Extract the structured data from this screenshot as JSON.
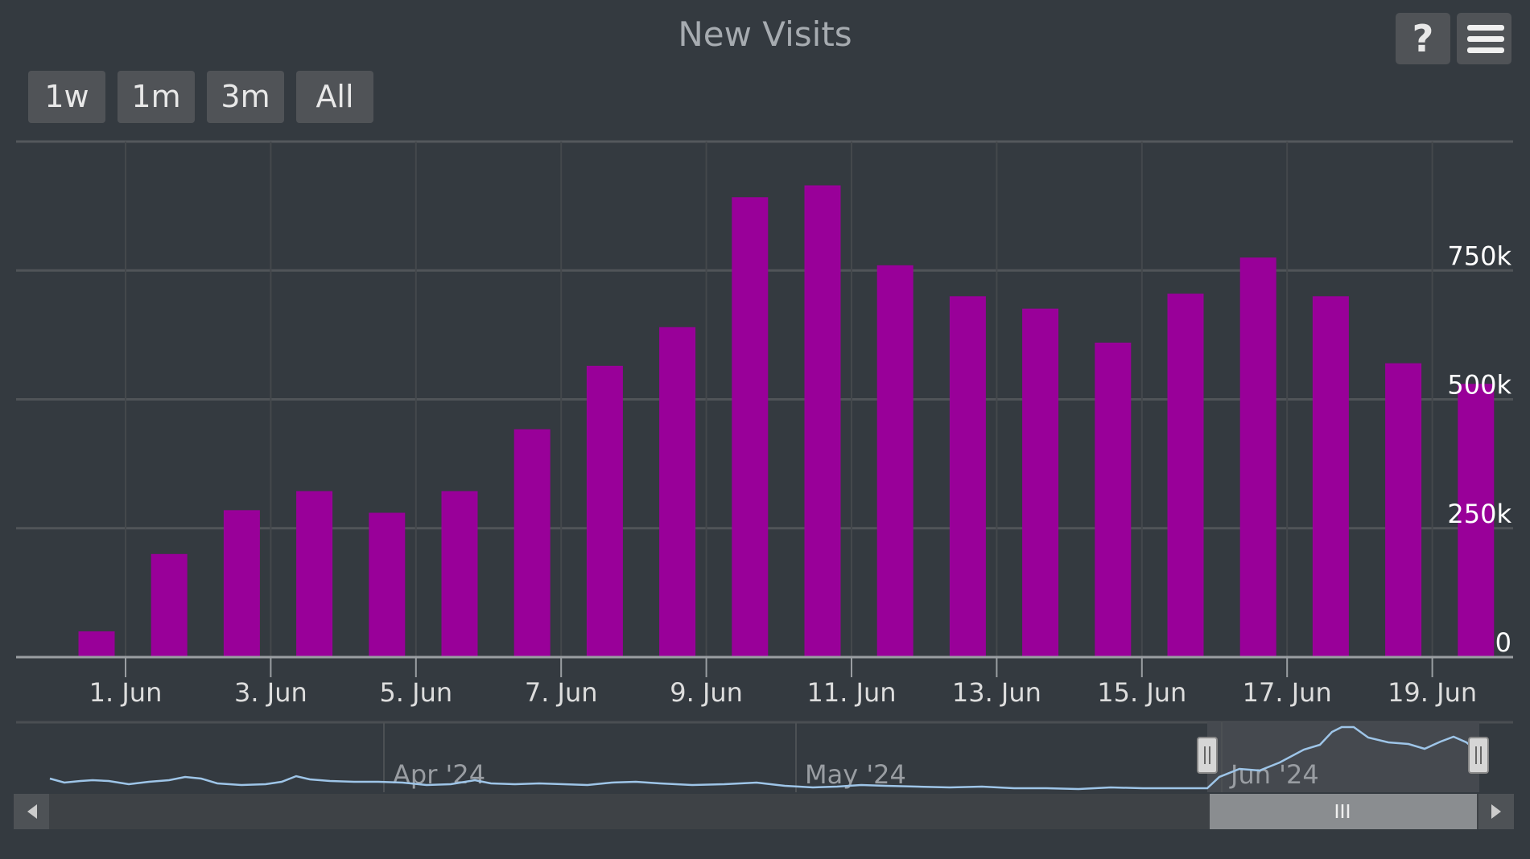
{
  "title": "New Visits",
  "range_selector": {
    "buttons": [
      {
        "label": "1w"
      },
      {
        "label": "1m"
      },
      {
        "label": "3m"
      },
      {
        "label": "All"
      }
    ]
  },
  "toolbar": {
    "help_label": "?",
    "help_icon": "question-icon",
    "menu_icon": "hamburger-menu-icon"
  },
  "colors": {
    "background": "#343a40",
    "bar": "#990099",
    "navigator_line": "#9ec5e8"
  },
  "chart_data": {
    "type": "bar",
    "x": [
      "1. Jun",
      "2. Jun",
      "3. Jun",
      "4. Jun",
      "5. Jun",
      "6. Jun",
      "7. Jun",
      "8. Jun",
      "9. Jun",
      "10. Jun",
      "11. Jun",
      "12. Jun",
      "13. Jun",
      "14. Jun",
      "15. Jun",
      "16. Jun",
      "17. Jun",
      "18. Jun",
      "19. Jun",
      "20. Jun"
    ],
    "values": [
      50000,
      200000,
      285000,
      322000,
      280000,
      322000,
      442000,
      565000,
      640000,
      892000,
      915000,
      760000,
      700000,
      676000,
      610000,
      705000,
      775000,
      700000,
      570000,
      530000
    ],
    "x_tick_labels": [
      "1. Jun",
      "3. Jun",
      "5. Jun",
      "7. Jun",
      "9. Jun",
      "11. Jun",
      "13. Jun",
      "15. Jun",
      "17. Jun",
      "19. Jun"
    ],
    "y_ticks": [
      0,
      250000,
      500000,
      750000
    ],
    "y_tick_labels": [
      "0",
      "250k",
      "500k",
      "750k"
    ],
    "ylim": [
      0,
      1000000
    ],
    "grid": true,
    "legend": "none",
    "navigator": {
      "labels": [
        "Apr '24",
        "May '24",
        "Jun '24"
      ],
      "selected_range": [
        "1. Jun",
        "20. Jun"
      ]
    }
  }
}
